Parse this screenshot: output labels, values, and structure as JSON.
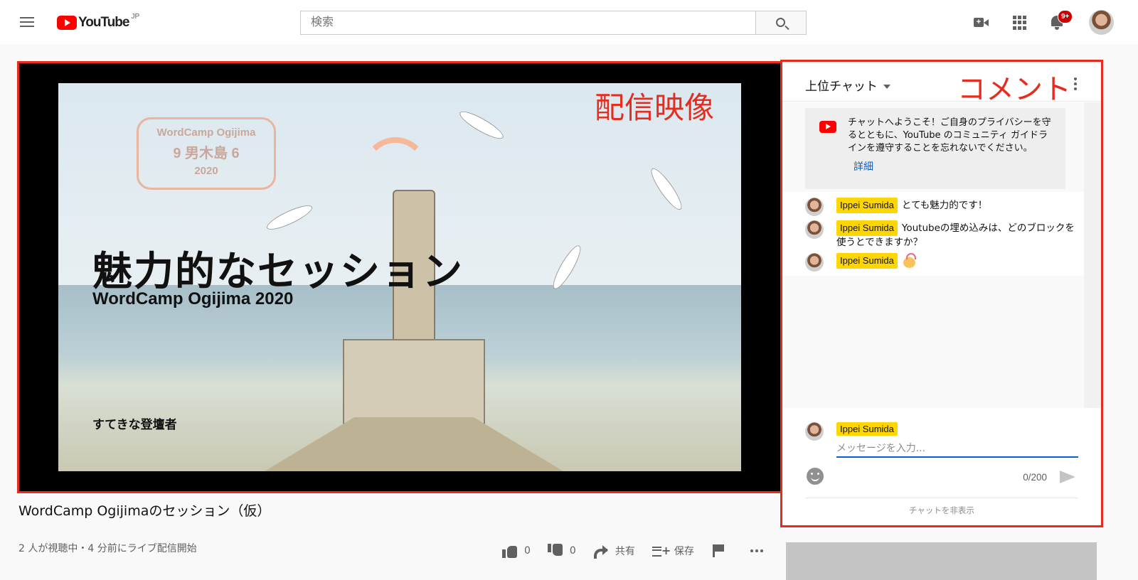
{
  "header": {
    "logo_text": "YouTube",
    "logo_region": "JP",
    "search_placeholder": "検索",
    "notification_count": "9+"
  },
  "video": {
    "slide_title": "魅力的なセッション",
    "slide_subtitle": "WordCamp Ogijima 2020",
    "slide_speaker": "すてきな登壇者",
    "sign_line1": "WordCamp Ogijima",
    "sign_line2": "9 男木島 6",
    "sign_line3": "2020",
    "annotation": "配信映像",
    "annotation_color": "#e52c1e"
  },
  "info": {
    "title": "WordCamp Ogijimaのセッション（仮）",
    "views": "2 人が視聴中・4 分前にライブ配信開始",
    "like_count": "0",
    "dislike_count": "0",
    "share_label": "共有",
    "save_label": "保存"
  },
  "chat": {
    "mode": "上位チャット",
    "annotation": "コメント",
    "welcome_text": "チャットへようこそ！ご自身のプライバシーを守るとともに、YouTube のコミュニティ ガイドラインを遵守することを忘れないでください。",
    "welcome_link": "詳細",
    "messages": [
      {
        "author": "Ippei Sumida",
        "text": "とても魅力的です！"
      },
      {
        "author": "Ippei Sumida",
        "text": "Youtubeの埋め込みは、どのブロックを使うとできますか？"
      },
      {
        "author": "Ippei Sumida",
        "text": ""
      }
    ],
    "composer_author": "Ippei Sumida",
    "input_placeholder": "メッセージを入力...",
    "char_count": "0/200",
    "hide_label": "チャットを非表示"
  }
}
